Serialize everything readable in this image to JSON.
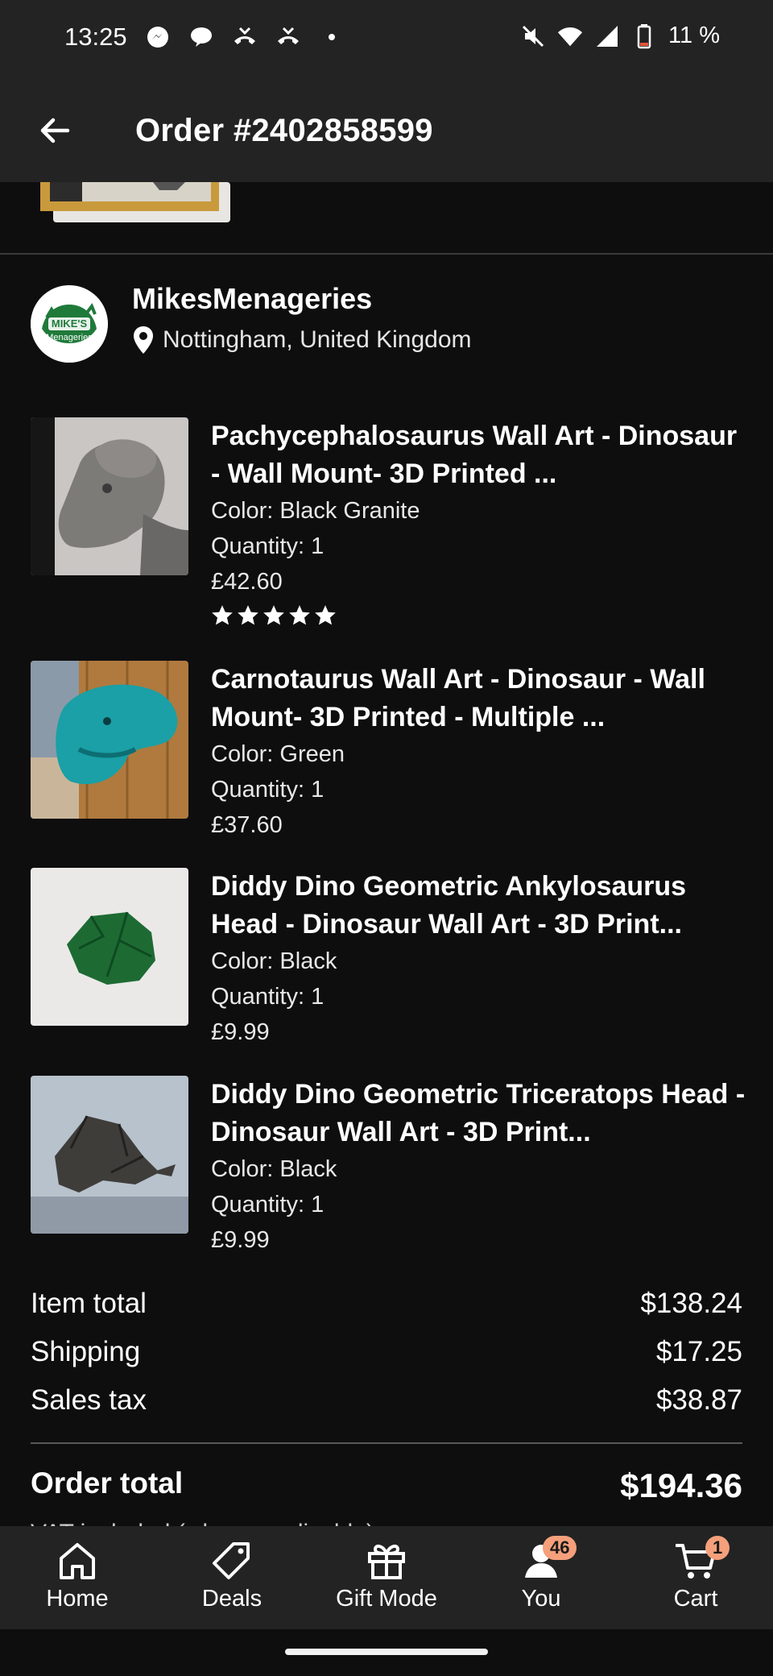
{
  "status_bar": {
    "time": "13:25",
    "battery": "11 %"
  },
  "header": {
    "title": "Order #2402858599"
  },
  "shop": {
    "name": "MikesMenageries",
    "location": "Nottingham, United Kingdom",
    "avatar_text": "MIKE'S Menageries"
  },
  "items": [
    {
      "title": "Pachycephalosaurus Wall Art - Dinosaur - Wall Mount- 3D Printed ...",
      "color": "Color: Black Granite",
      "quantity": "Quantity: 1",
      "price": "£42.60",
      "rating": 5
    },
    {
      "title": "Carnotaurus Wall Art - Dinosaur - Wall Mount- 3D Printed - Multiple ...",
      "color": "Color: Green",
      "quantity": "Quantity: 1",
      "price": "£37.60"
    },
    {
      "title": "Diddy Dino Geometric Ankylosaurus Head - Dinosaur Wall Art - 3D Print...",
      "color": "Color: Black",
      "quantity": "Quantity: 1",
      "price": "£9.99"
    },
    {
      "title": "Diddy Dino Geometric Triceratops Head - Dinosaur Wall Art - 3D Print...",
      "color": "Color: Black",
      "quantity": "Quantity: 1",
      "price": "£9.99"
    }
  ],
  "totals": {
    "item_total_label": "Item total",
    "item_total": "$138.24",
    "shipping_label": "Shipping",
    "shipping": "$17.25",
    "tax_label": "Sales tax",
    "tax": "$38.87",
    "order_total_label": "Order total",
    "order_total": "$194.36",
    "vat_note": "VAT included (where applicable)"
  },
  "nav": {
    "home": "Home",
    "deals": "Deals",
    "gift": "Gift Mode",
    "you": "You",
    "cart": "Cart",
    "you_badge": "46",
    "cart_badge": "1"
  },
  "colors": {
    "background": "#0e0e0f",
    "bar": "#232323",
    "badge": "#f5a07b"
  }
}
